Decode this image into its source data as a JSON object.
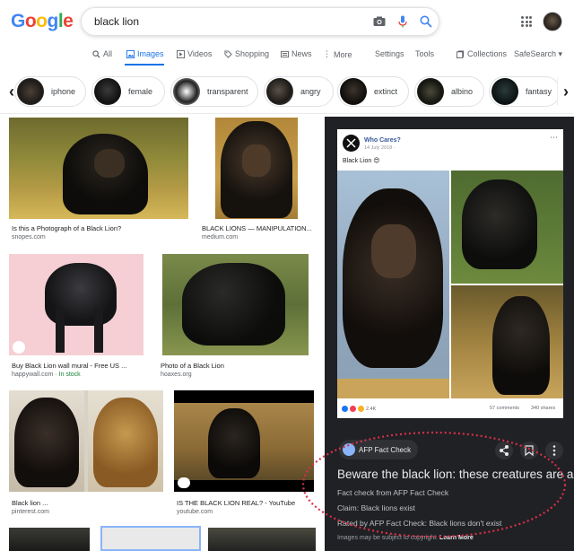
{
  "header": {
    "logo_letters": [
      "G",
      "o",
      "o",
      "g",
      "l",
      "e"
    ],
    "search_query": "black lion",
    "icons": [
      "camera-icon",
      "microphone-icon",
      "search-icon",
      "apps-icon"
    ]
  },
  "tabs": {
    "items": [
      "All",
      "Images",
      "Videos",
      "Shopping",
      "News",
      "More"
    ],
    "active": "Images",
    "settings": "Settings",
    "tools": "Tools",
    "collections": "Collections",
    "safesearch": "SafeSearch ▾"
  },
  "chips": [
    "iphone",
    "female",
    "transparent",
    "angry",
    "extinct",
    "albino",
    "fantasy"
  ],
  "results": [
    {
      "title": "Is this a Photograph of a Black Lion?",
      "source": "snopes.com"
    },
    {
      "title": "BLACK LIONS — MANIPULATION...",
      "source": "medium.com"
    },
    {
      "title": "Buy Black Lion wall mural - Free US ...",
      "source": "happywall.com",
      "stock": "In stock"
    },
    {
      "title": "Photo of a Black Lion",
      "source": "hoaxes.org"
    },
    {
      "title": "Black lion ...",
      "source": "pinterest.com"
    },
    {
      "title": "IS THE BLACK LION REAL? - YouTube",
      "source": "youtube.com"
    }
  ],
  "panel": {
    "post": {
      "name": "Who Cares?",
      "date": "14 July 2018 ·",
      "caption": "Black Lion 😍",
      "reactions_count": "2.4K",
      "comments": "57 comments",
      "shares": "340 shares"
    },
    "source_chip": "AFP Fact Check",
    "title": "Beware the black lion: these creatures are a...",
    "line1": "Fact check from AFP Fact Check",
    "line2": "Claim: Black lions exist",
    "line3": "Rated by AFP Fact Check: Black lions don't exist",
    "copyright": "Images may be subject to copyright.",
    "learn_more": "Learn More"
  },
  "colors": {
    "brand_blue": "#4285F4",
    "active_blue": "#1a73e8",
    "panel_bg": "#202124",
    "annotation_red": "#d6304a"
  }
}
